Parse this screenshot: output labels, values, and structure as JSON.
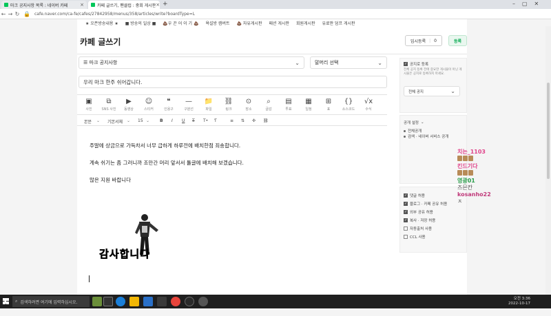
{
  "browser": {
    "tabs": [
      {
        "label": "마크 공지사항 목록 : 네이버 카페"
      },
      {
        "label": "카페 글쓰기, 팬클럽 : 중회 게시판"
      }
    ],
    "url": "cafe.naver.com/ca-fe/cafes/27842958/menus/358/articles/write?boardType=L"
  },
  "bookmarks": [
    "★ 오픈방송내용 ★",
    "■ 방송의 일상 ■",
    "💩우 끈 어 이 기 💩",
    "욕설방 캠버트",
    "💩 자유게시판",
    "패션 게시판",
    "회원게시판",
    "유료판 덤프 게시판"
  ],
  "editor": {
    "page_title": "카페 글쓰기",
    "temp_label": "임시등록",
    "temp_count": "0",
    "submit_label": "등록",
    "board_select": "☰ 마크 공지사항",
    "header_select": "말머리 선택",
    "subject": "우리 마크 한주 쉬어갑니다.",
    "tools": [
      {
        "icon": "▣",
        "label": "사진"
      },
      {
        "icon": "⧉",
        "label": "SNS 사진"
      },
      {
        "icon": "▶",
        "label": "동영상"
      },
      {
        "icon": "☺",
        "label": "스티커"
      },
      {
        "icon": "❝",
        "label": "인용구"
      },
      {
        "icon": "—",
        "label": "구분선"
      },
      {
        "icon": "📁",
        "label": "파일"
      },
      {
        "icon": "⛓",
        "label": "링크"
      },
      {
        "icon": "⊙",
        "label": "장소"
      },
      {
        "icon": "⌕",
        "label": "글감"
      },
      {
        "icon": "▤",
        "label": "투표"
      },
      {
        "icon": "▦",
        "label": "일정"
      },
      {
        "icon": "⊞",
        "label": "표"
      },
      {
        "icon": "{}",
        "label": "소스코드"
      },
      {
        "icon": "√x",
        "label": "수식"
      }
    ],
    "format": {
      "style": "본문",
      "font": "기본서체",
      "size": "15"
    },
    "body_lines": [
      "주말에 상금으로 가득차서 너무 급하게 하루전에 배치한점 죄송합니다.",
      "계속 쉬기는 좀 그러니까 조만간 머리 앞서서 툴글에 배치해 보겠습니다.",
      "많은 지원 바랍니다"
    ],
    "image_caption": "감사합니다"
  },
  "side": {
    "notice_check": "공지로 등록",
    "notice_desc": "전체 공지 등록 전에 중요한 게시물이 아닌 게시물은 공지로 등록하지 마세요.",
    "notice_select": "전체 공지",
    "visibility_title": "공개 설정",
    "visibility_opts": [
      "전체공개",
      "검색 · 네이버 서비스 공개"
    ],
    "options": [
      {
        "label": "댓글 허용",
        "checked": true
      },
      {
        "label": "블로그 · 카페 공유 허용",
        "checked": true
      },
      {
        "label": "외부 공유 허용",
        "checked": true
      },
      {
        "label": "복사 · 저장 허용",
        "checked": true
      },
      {
        "label": "자동출처 사용",
        "checked": false
      },
      {
        "label": "CCL 사용",
        "checked": false
      }
    ]
  },
  "chat": [
    {
      "name": "치는_1103",
      "color": "#e0438a"
    },
    {
      "name": "킨드기다",
      "color": "#e0438a"
    },
    {
      "name": "영광01",
      "color": "#2a9d4a"
    },
    {
      "name": "즈믄칸",
      "color": "#555"
    },
    {
      "name": "kosanho22",
      "color": "#c0397a"
    },
    {
      "name": "ㅈ",
      "color": "#555"
    }
  ],
  "taskbar": {
    "search_placeholder": "검색하려면 여기에 입력하십시오.",
    "time": "오전 3:36",
    "date": "2022-10-17"
  }
}
